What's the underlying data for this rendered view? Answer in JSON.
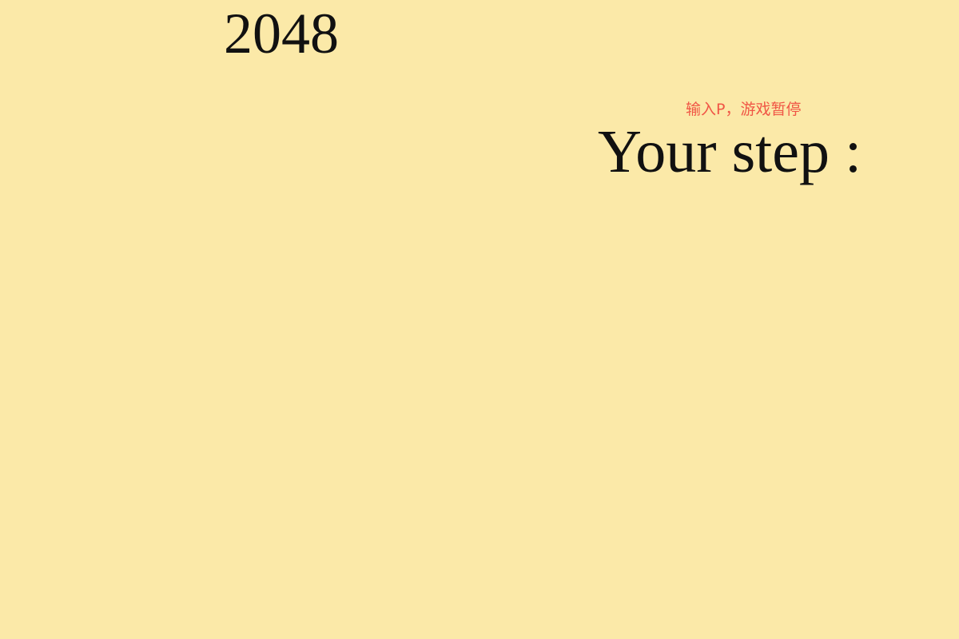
{
  "title": "2048",
  "hint": "输入P，游戏暂停",
  "step_label": "Your step :",
  "colors": {
    "background": "#fbe9a8",
    "text": "#111111",
    "hint": "#f05545"
  }
}
